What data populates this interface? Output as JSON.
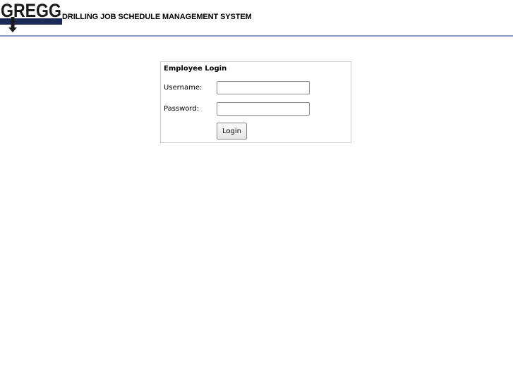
{
  "header": {
    "logo_text": "GREGG",
    "app_title": "DRILLING JOB SCHEDULE MANAGEMENT SYSTEM"
  },
  "login": {
    "title": "Employee Login",
    "username_label": "Username:",
    "username_value": "",
    "password_label": "Password:",
    "password_value": "",
    "submit_label": "Login"
  },
  "colors": {
    "logo_bar": "#1b2b55",
    "header_rule": "#8d9bc8"
  }
}
